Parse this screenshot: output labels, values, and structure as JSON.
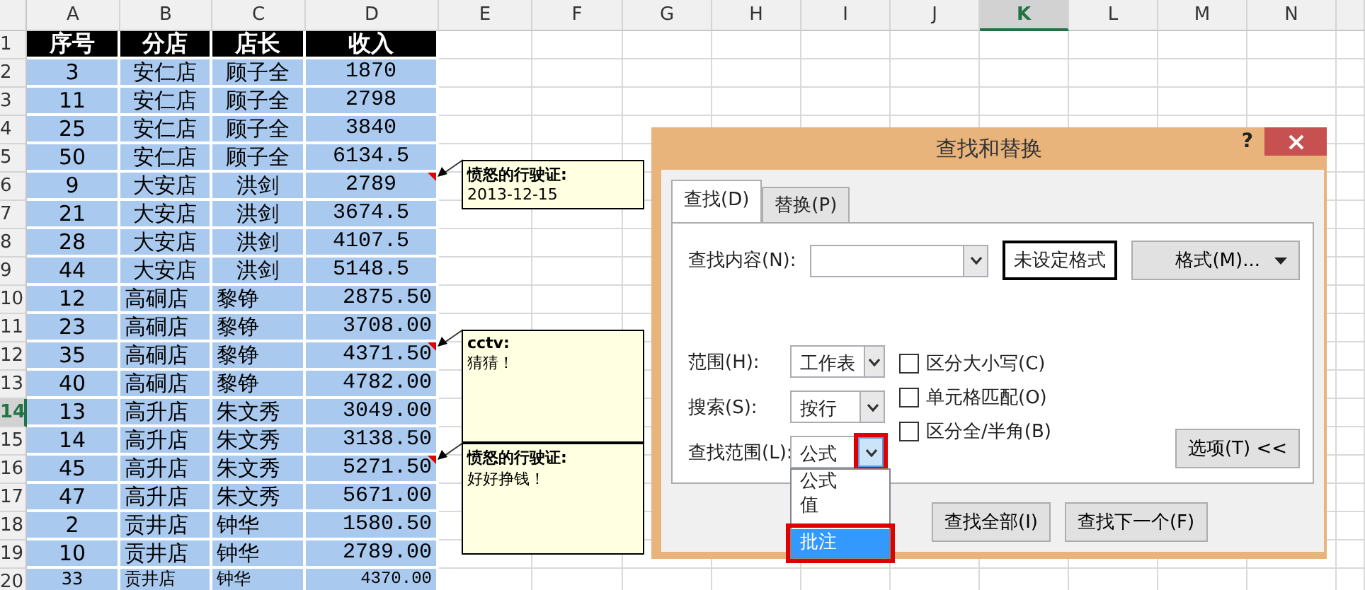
{
  "sheet": {
    "columns": [
      {
        "label": "A",
        "selected": false
      },
      {
        "label": "B",
        "selected": false
      },
      {
        "label": "C",
        "selected": false
      },
      {
        "label": "D",
        "selected": false
      },
      {
        "label": "E",
        "selected": false
      },
      {
        "label": "F",
        "selected": false
      },
      {
        "label": "G",
        "selected": false
      },
      {
        "label": "H",
        "selected": false
      },
      {
        "label": "I",
        "selected": false
      },
      {
        "label": "J",
        "selected": false
      },
      {
        "label": "K",
        "selected": true
      },
      {
        "label": "L",
        "selected": false
      },
      {
        "label": "M",
        "selected": false
      },
      {
        "label": "N",
        "selected": false
      }
    ],
    "header_row": {
      "number": "1",
      "selected": false,
      "cells": [
        "序号",
        "分店",
        "店长",
        "收入"
      ]
    },
    "rows": [
      {
        "number": "2",
        "selected": false,
        "kind": "centered",
        "cells": [
          "3",
          "安仁店",
          "顾子全",
          "1870"
        ]
      },
      {
        "number": "3",
        "selected": false,
        "kind": "centered",
        "cells": [
          "11",
          "安仁店",
          "顾子全",
          "2798"
        ]
      },
      {
        "number": "4",
        "selected": false,
        "kind": "centered",
        "cells": [
          "25",
          "安仁店",
          "顾子全",
          "3840"
        ]
      },
      {
        "number": "5",
        "selected": false,
        "kind": "centered",
        "cells": [
          "50",
          "安仁店",
          "顾子全",
          "6134.5"
        ]
      },
      {
        "number": "6",
        "selected": false,
        "kind": "centered",
        "cells": [
          "9",
          "大安店",
          "洪剑",
          "2789"
        ],
        "comment": {
          "author": "愤怒的行驶证:",
          "text": "2013-12-15"
        }
      },
      {
        "number": "7",
        "selected": false,
        "kind": "centered",
        "cells": [
          "21",
          "大安店",
          "洪剑",
          "3674.5"
        ]
      },
      {
        "number": "8",
        "selected": false,
        "kind": "centered",
        "cells": [
          "28",
          "大安店",
          "洪剑",
          "4107.5"
        ]
      },
      {
        "number": "9",
        "selected": false,
        "kind": "centered",
        "cells": [
          "44",
          "大安店",
          "洪剑",
          "5148.5"
        ]
      },
      {
        "number": "10",
        "selected": false,
        "kind": "left",
        "cells": [
          "12",
          "高硐店",
          "黎铮",
          "2875.50"
        ]
      },
      {
        "number": "11",
        "selected": false,
        "kind": "left",
        "cells": [
          "23",
          "高硐店",
          "黎铮",
          "3708.00"
        ]
      },
      {
        "number": "12",
        "selected": false,
        "kind": "left",
        "cells": [
          "35",
          "高硐店",
          "黎铮",
          "4371.50"
        ],
        "comment": {
          "author": "cctv:",
          "text": "猜猜！"
        }
      },
      {
        "number": "13",
        "selected": false,
        "kind": "left",
        "cells": [
          "40",
          "高硐店",
          "黎铮",
          "4782.00"
        ]
      },
      {
        "number": "14",
        "selected": true,
        "kind": "left",
        "cells": [
          "13",
          "高升店",
          "朱文秀",
          "3049.00"
        ]
      },
      {
        "number": "15",
        "selected": false,
        "kind": "left",
        "cells": [
          "14",
          "高升店",
          "朱文秀",
          "3138.50"
        ]
      },
      {
        "number": "16",
        "selected": false,
        "kind": "left",
        "cells": [
          "45",
          "高升店",
          "朱文秀",
          "5271.50"
        ],
        "comment": {
          "author": "愤怒的行驶证:",
          "text": "好好挣钱！"
        }
      },
      {
        "number": "17",
        "selected": false,
        "kind": "left",
        "cells": [
          "47",
          "高升店",
          "朱文秀",
          "5671.00"
        ]
      },
      {
        "number": "18",
        "selected": false,
        "kind": "left",
        "cells": [
          "2",
          "贡井店",
          "钟华",
          "1580.50"
        ]
      },
      {
        "number": "19",
        "selected": false,
        "kind": "left",
        "cells": [
          "10",
          "贡井店",
          "钟华",
          "2789.00"
        ]
      },
      {
        "number": "20",
        "selected": false,
        "kind": "left",
        "cells": [
          "33",
          "贡井店",
          "钟华",
          "4370.00"
        ]
      }
    ]
  },
  "dialog": {
    "title": "查找和替换",
    "help": "?",
    "tabs": [
      {
        "label": "查找(D)",
        "selected": true
      },
      {
        "label": "替换(P)",
        "selected": false
      }
    ],
    "find_label": "查找内容(N):",
    "format_preview": "未设定格式",
    "format_button": "格式(M)...",
    "options": [
      {
        "label": "范围(H):",
        "value": "工作表",
        "expanded": false,
        "marked": false
      },
      {
        "label": "搜索(S):",
        "value": "按行",
        "expanded": false,
        "marked": false
      },
      {
        "label": "查找范围(L):",
        "value": "公式",
        "expanded": true,
        "marked": true
      }
    ],
    "checkboxes": [
      {
        "label": "区分大小写(C)",
        "checked": false
      },
      {
        "label": "单元格匹配(O)",
        "checked": false
      },
      {
        "label": "区分全/半角(B)",
        "checked": false
      }
    ],
    "options_button": "选项(T) <<",
    "dropdown_items": [
      {
        "label": "公式",
        "selected": false,
        "marked": false
      },
      {
        "label": "值",
        "selected": false,
        "marked": false
      },
      {
        "label": "批注",
        "selected": true,
        "marked": true
      }
    ],
    "buttons": [
      "查找全部(I)",
      "查找下一个(F)"
    ]
  }
}
